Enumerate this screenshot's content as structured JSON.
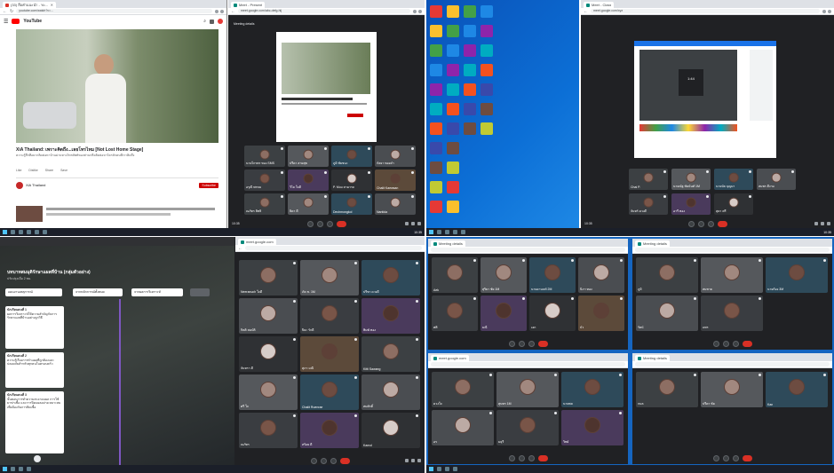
{
  "youtube": {
    "tab": "(33) สื่อคำแนะนำ - YouTube",
    "url": "youtube.com/watch?v=...",
    "logo": "YouTube",
    "title": "XiA Thailand: เพราะคิดถึง...เลยโทรไหม [Not Lost Home Stage]",
    "desc": "ความรู้สึกที่อยากติดต่อหาบ้านผ่านทางโทรศัพท์ของท่านหรือติดต่อหาใครสักคนที่เราคิดถึง",
    "channel": "XiA Thailand",
    "subscribe": "Subscribe",
    "actions": [
      "Like",
      "Dislike",
      "Share",
      "Save"
    ]
  },
  "meet1": {
    "tab": "Meet - Present",
    "url": "meet.google.com/abc-defg-hij",
    "info": "Meeting details",
    "tiles": [
      "นายไกรพร ทอง SMS",
      "ปรีดา สายสุข",
      "ภูมิ ชัยชนะ",
      "กัลยา ทองคำ",
      "อรุณี พรหม",
      "วิไล ใจดี",
      "P. Muu สามารถ",
      "Chalit Kaewsan",
      "ณภัทร สิทธิ",
      "ธิดา ดี",
      "Dechmongkol",
      "Nantida"
    ]
  },
  "desktop": {
    "icons": 8
  },
  "meet2": {
    "tab": "Meet - Class",
    "url": "meet.google.com/xyz",
    "tiles": [
      "Chai P.",
      "นายณัฐ ชัยนันท์ 1M",
      "นายนัธ บุญมา",
      "สมพร ดีงาม",
      "จันทร์ ดวงดี",
      "อารี ทอง",
      "สุดา ศรี"
    ],
    "screen_time": "1:44"
  },
  "padlet": {
    "title": "บทบาทสมมุติรักษาแผลที่บ้าน (กลุ่มตัวอย่าง)",
    "sub": "ปรับปรุงเมื่อ 2 ชม.",
    "cols": [
      "แผนงานเหตุการณ์",
      "จากหลักการณ์ทั้งหมด",
      "จากผลการวิเคราะห์"
    ],
    "cards": [
      {
        "name": "นักเรียนคนที่ 1",
        "body": "ผลการวิเคราะห์ให้ความสำคัญกับการรักษาแผลที่บ้านอย่างถูกวิธี"
      },
      {
        "name": "นักเรียนคนที่ 2",
        "body": "ความรู้เรื่องการทำแผลที่ถูกต้องและปลอดภัยสำหรับทุกคนในครอบครัว"
      },
      {
        "name": "นักเรียนคนที่ 3",
        "body": "ขั้นตอนการทำความสะอาดแผล การใช้ยาฆ่าเชื้อ และการปิดแผลอย่างเหมาะสม เพื่อป้องกันการติดเชื้อ"
      }
    ]
  },
  "meet3": {
    "tiles": [
      "Neeranuch ใจดี",
      "ภัค ช. 1M",
      "ปรีชา ดวงดี",
      "กิตติ สมบัติ",
      "ปิยะ รักดี",
      "พิมพ์ ทอง",
      "จันทรา ดี",
      "สุภา มณี",
      "Kitti Sawang",
      "ศรี ใจ",
      "Chalit Ruenrae",
      "สมศักดิ์",
      "ณภัทร",
      "สร้อย ดี",
      "Kamol"
    ],
    "info": "meet.google.com"
  },
  "meet4": {
    "tiles": [
      "Aek",
      "สุริยา ชัย 1M",
      "นายอานนท์ 2M",
      "นิภา ทอง",
      "ศศิ",
      "มณี",
      "เอก",
      "บัว"
    ],
    "info": "Meeting details"
  },
  "meet5": {
    "tiles": [
      "ภูมิ",
      "สมชาย",
      "นายก้อง 3M",
      "รัตน์",
      "แพร"
    ],
    "info": "Meeting details"
  },
  "meet6": {
    "tiles": [
      "ดวงใจ",
      "สุนทร 1M",
      "นายพล",
      "อร",
      "มยุรี",
      "วิทย์"
    ],
    "info": "meet.google.com"
  },
  "meet7": {
    "tiles": [
      "กมล",
      "ปรีดา ชัย",
      "Kan"
    ],
    "info": "Meeting details"
  },
  "clock": {
    "time": "10:35",
    "date": "6/10/2564"
  },
  "colors": {
    "meet_bg": "#202124",
    "accent": "#1a73e8",
    "end_call": "#d93025",
    "taskbar": "#1b1f29",
    "youtube_red": "#ff0000"
  }
}
